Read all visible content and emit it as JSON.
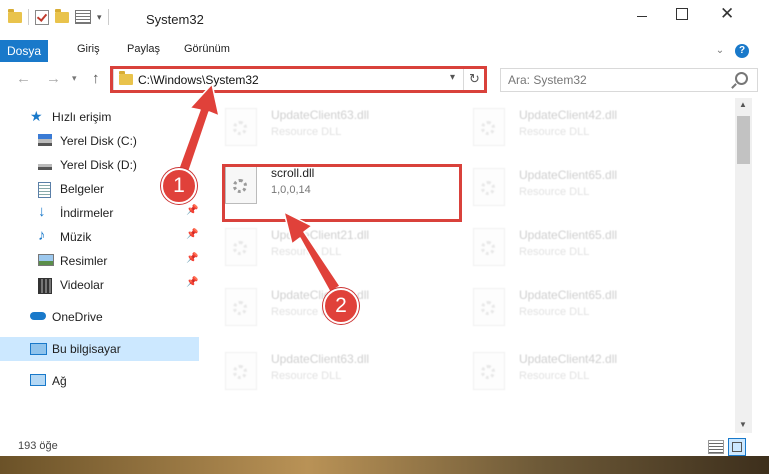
{
  "window": {
    "title": "System32"
  },
  "ribbon": {
    "tabs": [
      "Dosya",
      "Giriş",
      "Paylaş",
      "Görünüm"
    ],
    "help": "?"
  },
  "address": {
    "path": "C:\\Windows\\System32"
  },
  "search": {
    "placeholder": "Ara: System32"
  },
  "sidebar": {
    "items": [
      {
        "label": "Hızlı erişim"
      },
      {
        "label": "Yerel Disk (C:)"
      },
      {
        "label": "Yerel Disk (D:)"
      },
      {
        "label": "Belgeler"
      },
      {
        "label": "İndirmeler"
      },
      {
        "label": "Müzik"
      },
      {
        "label": "Resimler"
      },
      {
        "label": "Videolar"
      },
      {
        "label": "OneDrive"
      },
      {
        "label": "Bu bilgisayar"
      },
      {
        "label": "Ağ"
      }
    ]
  },
  "files": {
    "left": [
      {
        "name": "UpdateClient63.dll",
        "desc": "Resource DLL"
      },
      {
        "name": "scroll.dll",
        "desc": "1,0,0,14"
      },
      {
        "name": "UpdateClient21.dll",
        "desc": "Resource DLL"
      },
      {
        "name": "UpdateClient63.dll",
        "desc": "Resource DLL"
      },
      {
        "name": "UpdateClient63.dll",
        "desc": "Resource DLL"
      }
    ],
    "right": [
      {
        "name": "UpdateClient42.dll",
        "desc": "Resource DLL"
      },
      {
        "name": "UpdateClient65.dll",
        "desc": "Resource DLL"
      },
      {
        "name": "UpdateClient65.dll",
        "desc": "Resource DLL"
      },
      {
        "name": "UpdateClient65.dll",
        "desc": "Resource DLL"
      },
      {
        "name": "UpdateClient42.dll",
        "desc": "Resource DLL"
      }
    ]
  },
  "status": {
    "count": "193 öğe"
  },
  "callouts": {
    "one": "1",
    "two": "2"
  },
  "colors": {
    "accent": "#1979ca",
    "highlight": "#d9413b",
    "selected": "#cce8ff"
  }
}
